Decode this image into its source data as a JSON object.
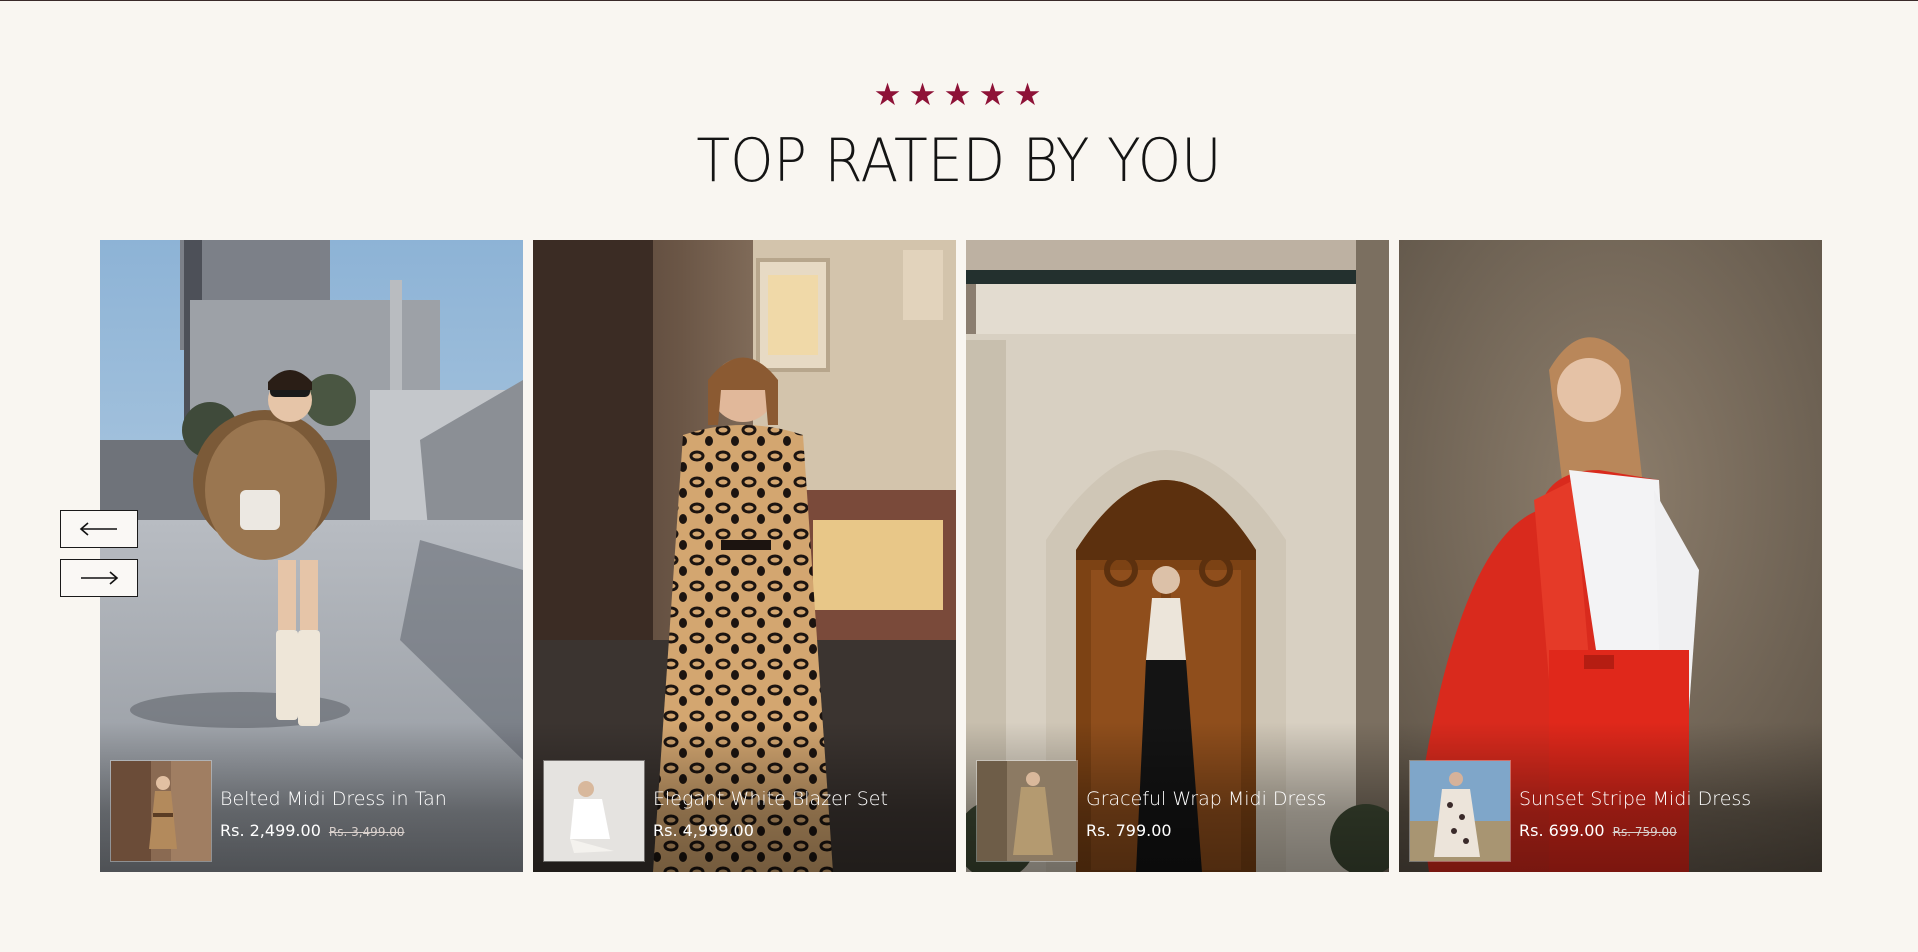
{
  "header": {
    "stars": [
      "★",
      "★",
      "★",
      "★",
      "★"
    ],
    "title": "TOP RATED BY YOU"
  },
  "colors": {
    "accent": "#8e1237",
    "background": "#f9f6f1"
  },
  "carousel": {
    "prev_icon": "arrow-left-icon",
    "next_icon": "arrow-right-icon",
    "products": [
      {
        "name": "Belted Midi Dress in Tan",
        "price": "Rs. 2,499.00",
        "compare_price": "Rs. 3,499.00"
      },
      {
        "name": "Elegant White Blazer Set",
        "price": "Rs. 4,999.00",
        "compare_price": ""
      },
      {
        "name": "Graceful Wrap Midi Dress",
        "price": "Rs. 799.00",
        "compare_price": ""
      },
      {
        "name": "Sunset Stripe Midi Dress",
        "price": "Rs. 699.00",
        "compare_price": "Rs. 759.00"
      }
    ]
  }
}
